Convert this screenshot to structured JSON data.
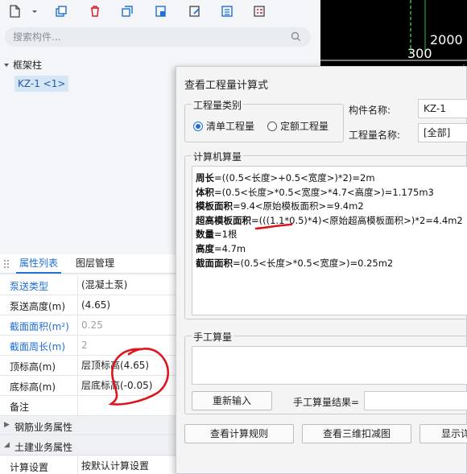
{
  "toolbar": {
    "icons": [
      "new-file-icon",
      "dropdown-icon",
      "copy-icon",
      "delete-icon",
      "duplicate-icon",
      "layer-copy-icon",
      "edit-icon",
      "list-icon",
      "table-icon"
    ]
  },
  "search": {
    "placeholder": "搜索构件..."
  },
  "tree": {
    "root_label": "框架柱",
    "item_label": "KZ-1 <1>"
  },
  "properties": {
    "tab_active": "属性列表",
    "tab_other": "图层管理",
    "rows": [
      {
        "key": "泵送类型",
        "value": "(混凝土泵)"
      },
      {
        "key": "泵送高度(m)",
        "value": "(4.65)"
      },
      {
        "key": "截面面积(m²)",
        "value": "0.25"
      },
      {
        "key": "截面周长(m)",
        "value": "2"
      },
      {
        "key": "顶标高(m)",
        "value": "层顶标高(4.65)"
      },
      {
        "key": "底标高(m)",
        "value": "层底标高(-0.05)"
      },
      {
        "key": "备注",
        "value": ""
      }
    ],
    "section_rebar": "钢筋业务属性",
    "section_civil": "土建业务属性",
    "calc_setting_key": "计算设置",
    "calc_setting_value": "按默认计算设置"
  },
  "canvas": {
    "label_2000": "2000",
    "label_300": "300"
  },
  "dialog": {
    "title": "查看工程量计算式",
    "type_group_label": "工程量类别",
    "radio_bill": "清单工程量",
    "radio_quota": "定额工程量",
    "component_name_label": "构件名称:",
    "component_name_value": "KZ-1",
    "quantity_name_label": "工程量名称:",
    "quantity_name_value": "[全部]",
    "calc_group_label": "计算机算量",
    "calc_lines": [
      {
        "name": "周长",
        "expr": "=((0.5<长度>+0.5<宽度>)*2)=2m"
      },
      {
        "name": "体积",
        "expr": "=(0.5<长度>*0.5<宽度>*4.7<高度>)=1.175m3"
      },
      {
        "name": "模板面积",
        "expr": "=9.4<原始模板面积>=9.4m2"
      },
      {
        "name": "超高模板面积",
        "expr": "=(((1.1*0.5)*4)<原始超高模板面积>)*2=4.4m2"
      },
      {
        "name": "数量",
        "expr": "=1根"
      },
      {
        "name": "高度",
        "expr": "=4.7m"
      },
      {
        "name": "截面面积",
        "expr": "=(0.5<长度>*0.5<宽度>)=0.25m2"
      }
    ],
    "manual_group_label": "手工算量",
    "reenter_button": "重新输入",
    "manual_result_label": "手工算量结果=",
    "btn_rules": "查看计算规则",
    "btn_3d": "查看三维扣减图",
    "btn_detail": "显示详"
  },
  "colors": {
    "accent": "#1f6fd6",
    "annotation_red": "#e0141c",
    "canvas_bg": "#000000"
  }
}
